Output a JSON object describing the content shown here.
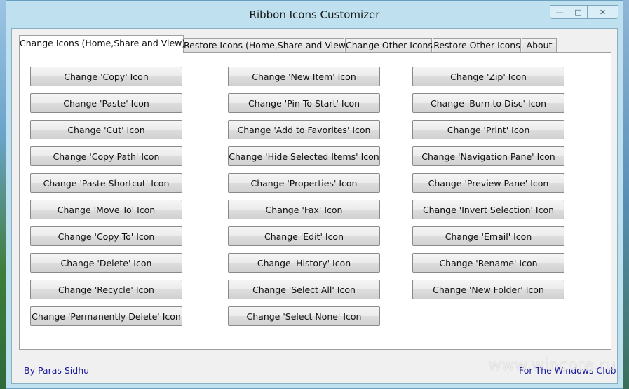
{
  "window": {
    "title": "Ribbon Icons Customizer",
    "controls": {
      "minimize": "—",
      "maximize": "□",
      "close": "✕"
    }
  },
  "tabs": [
    {
      "label": "Change Icons (Home,Share and View)",
      "active": true
    },
    {
      "label": "Restore Icons (Home,Share and View)",
      "active": false
    },
    {
      "label": "Change Other Icons",
      "active": false
    },
    {
      "label": "Restore Other Icons",
      "active": false
    },
    {
      "label": "About",
      "active": false
    }
  ],
  "buttons": {
    "col1": [
      "Change 'Copy' Icon",
      "Change 'Paste' Icon",
      "Change 'Cut' Icon",
      "Change 'Copy Path' Icon",
      "Change 'Paste Shortcut' Icon",
      "Change 'Move To' Icon",
      "Change 'Copy To' Icon",
      "Change 'Delete' Icon",
      "Change 'Recycle' Icon",
      "Change 'Permanently Delete' Icon"
    ],
    "col2": [
      "Change 'New Item' Icon",
      "Change 'Pin To Start' Icon",
      "Change 'Add to Favorites' Icon",
      "Change 'Hide Selected Items' Icon",
      "Change 'Properties' Icon",
      "Change 'Fax' Icon",
      "Change 'Edit' Icon",
      "Change 'History' Icon",
      "Change 'Select All' Icon",
      "Change 'Select None' Icon"
    ],
    "col3": [
      "Change 'Zip' Icon",
      "Change 'Burn to Disc' Icon",
      "Change 'Print' Icon",
      "Change 'Navigation Pane' Icon",
      "Change 'Preview Pane' Icon",
      "Change 'Invert Selection' Icon",
      "Change 'Email' Icon",
      "Change 'Rename' Icon",
      "Change 'New Folder' Icon"
    ]
  },
  "footer": {
    "author": "By Paras Sidhu",
    "club": "For The Windows Club"
  },
  "watermark": "www.wincore.ru"
}
